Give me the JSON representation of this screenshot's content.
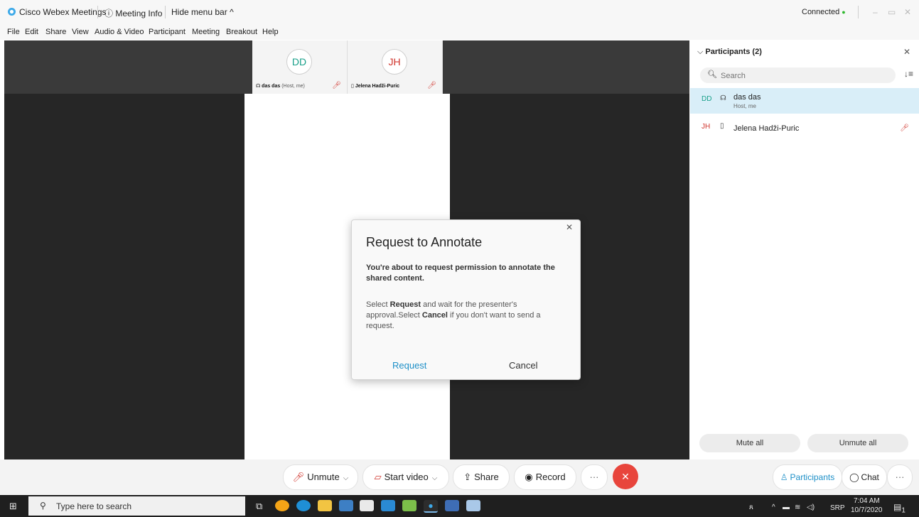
{
  "titlebar": {
    "app_title": "Cisco Webex Meetings",
    "meeting_info": "Meeting Info",
    "hide_menu": "Hide menu bar",
    "status": "Connected"
  },
  "menubar": [
    "File",
    "Edit",
    "Share",
    "View",
    "Audio & Video",
    "Participant",
    "Meeting",
    "Breakout",
    "Help"
  ],
  "tiles": [
    {
      "initials": "DD",
      "name": "das das",
      "role": "(Host, me)",
      "color": "#19a08a"
    },
    {
      "initials": "JH",
      "name": "Jelena Hadži-Puric",
      "role": "",
      "color": "#d0342c"
    }
  ],
  "dialog": {
    "title": "Request to Annotate",
    "bold_line": "You're about to request permission to annotate the shared content.",
    "body_pre": "Select ",
    "body_req": "Request",
    "body_mid": " and wait for the presenter's approval.Select ",
    "body_cancel": "Cancel",
    "body_post": " if you don't want to send a request.",
    "request_label": "Request",
    "cancel_label": "Cancel"
  },
  "panel": {
    "title": "Participants (2)",
    "search_placeholder": "Search",
    "participants": [
      {
        "initials": "DD",
        "name": "das das",
        "subtitle": "Host, me",
        "icon": "headset-icon"
      },
      {
        "initials": "JH",
        "name": "Jelena Hadži-Puric",
        "subtitle": "",
        "icon": "phone-icon"
      }
    ],
    "mute_all": "Mute all",
    "unmute_all": "Unmute all"
  },
  "toolbar": {
    "unmute": "Unmute",
    "start_video": "Start video",
    "share": "Share",
    "record": "Record",
    "more": "···",
    "participants": "Participants",
    "chat": "Chat"
  },
  "taskbar": {
    "search_placeholder": "Type here to search",
    "lang": "SRP",
    "time": "7:04 AM",
    "date": "10/7/2020",
    "notif_count": "1"
  },
  "colors": {
    "accent": "#1e90c8",
    "end_call": "#e8453c",
    "mic_muted": "#d0342c",
    "connected": "#2eb82e"
  }
}
